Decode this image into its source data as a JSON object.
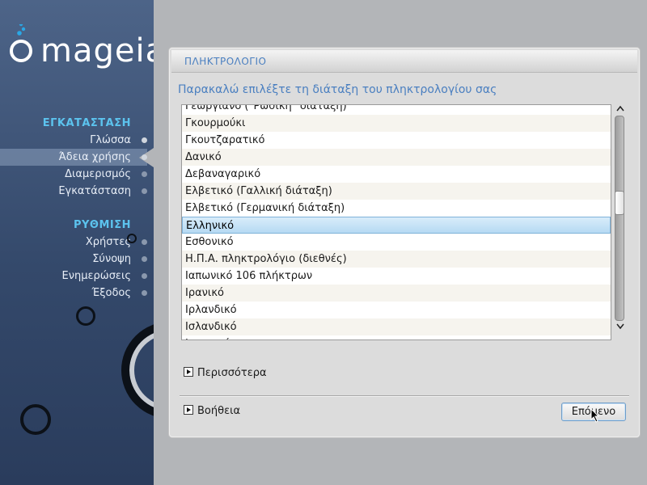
{
  "sidebar": {
    "logo_text": "mageia",
    "sections": [
      {
        "heading": "ΕΓΚΑΤΑΣΤΑΣΗ",
        "items": [
          {
            "label": "Γλώσσα"
          },
          {
            "label": "Άδεια χρήσης"
          },
          {
            "label": "Διαμερισμός"
          },
          {
            "label": "Εγκατάσταση"
          }
        ]
      },
      {
        "heading": "ΡΥΘΜΙΣΗ",
        "items": [
          {
            "label": "Χρήστες"
          },
          {
            "label": "Σύνοψη"
          },
          {
            "label": "Ενημερώσεις"
          },
          {
            "label": "Έξοδος"
          }
        ]
      }
    ],
    "active_item": "Άδεια χρήσης"
  },
  "dialog": {
    "title": "ΠΛΗΚΤΡΟΛΟΓΙΟ",
    "subtitle": "Παρακαλώ επιλέξτε τη διάταξη του πληκτρολογίου σας",
    "keyboard_layouts": [
      "Γεωργιανό (\"Ρωσική\" διάταξη)",
      "Γκουρμούκι",
      "Γκουτζαρατικό",
      "Δανικό",
      "Δεβαναγαρικό",
      "Ελβετικό (Γαλλική διάταξη)",
      "Ελβετικό (Γερμανική διάταξη)",
      "Ελληνικό",
      "Εσθονικό",
      "Η.Π.Α. πληκτρολόγιο (διεθνές)",
      "Ιαπωνικό 106 πλήκτρων",
      "Ιρανικό",
      "Ιρλανδικό",
      "Ισλανδικό",
      "Ισπανικό"
    ],
    "selected_layout": "Ελληνικό",
    "scroll_position": 0.41,
    "more_label": "Περισσότερα",
    "help_label": "Βοήθεια",
    "next_label": "Επόμενο"
  },
  "colors": {
    "accent": "#4a7fc0",
    "sidebar_heading": "#5cc3ee",
    "sidebar_bg": "#3d5278",
    "selection": "#b5daf3"
  },
  "icons": {
    "scroll_up": "chevron-up-icon",
    "scroll_down": "chevron-down-icon",
    "expander": "triangle-right-icon"
  }
}
